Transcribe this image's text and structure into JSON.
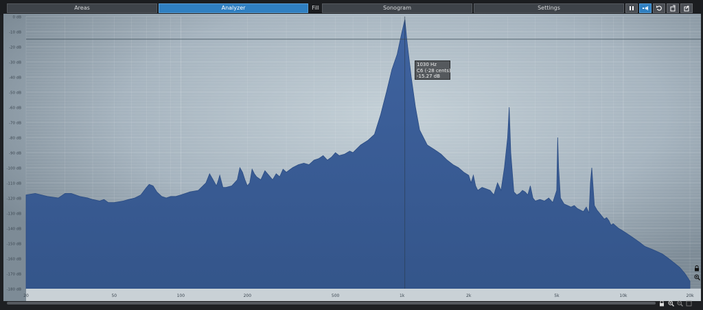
{
  "tabs": {
    "areas": "Areas",
    "analyzer": "Analyzer",
    "fill": "Fill",
    "sonogram": "Sonogram",
    "settings": "Settings"
  },
  "toolbar_icons": [
    "pause-icon",
    "freeze-icon",
    "reset-icon",
    "undo-icon",
    "export-icon"
  ],
  "colors": {
    "accent": "#2f7fc1",
    "spectrum_fill": "#3a5d96",
    "background_light": "#c4d0d7",
    "background_dark": "#7d8b96"
  },
  "tooltip": {
    "freq": "1030 Hz",
    "note": "C6 (-28 cents)",
    "level": "-15.27 dB"
  },
  "chart_data": {
    "type": "area",
    "x_scale": "log",
    "xlim": [
      20,
      20000
    ],
    "ylim": [
      -180,
      0
    ],
    "grid": true,
    "y_ticks": [
      "0 dB",
      "-10 dB",
      "-20 dB",
      "-30 dB",
      "-40 dB",
      "-50 dB",
      "-60 dB",
      "-70 dB",
      "-80 dB",
      "-90 dB",
      "-100 dB",
      "-110 dB",
      "-120 dB",
      "-130 dB",
      "-140 dB",
      "-150 dB",
      "-160 dB",
      "-170 dB",
      "-180 dB"
    ],
    "y_tick_values": [
      0,
      -10,
      -20,
      -30,
      -40,
      -50,
      -60,
      -70,
      -80,
      -90,
      -100,
      -110,
      -120,
      -130,
      -140,
      -150,
      -160,
      -170,
      -180
    ],
    "x_ticks": [
      "20",
      "50",
      "100",
      "200",
      "500",
      "1k",
      "2k",
      "5k",
      "10k",
      "20k"
    ],
    "x_tick_values": [
      20,
      50,
      100,
      200,
      500,
      1000,
      2000,
      5000,
      10000,
      20000
    ],
    "threshold_line_db": -15,
    "cursor_freq": 1030,
    "series": [
      {
        "x": [
          20,
          22,
          25,
          28,
          30,
          32,
          35,
          38,
          40,
          43,
          45,
          47,
          50,
          55,
          58,
          62,
          66,
          70,
          72,
          75,
          78,
          82,
          86,
          90,
          95,
          100,
          105,
          110,
          120,
          130,
          135,
          140,
          145,
          148,
          150,
          155,
          160,
          170,
          180,
          185,
          190,
          195,
          200,
          205,
          210,
          215,
          220,
          230,
          240,
          250,
          260,
          270,
          280,
          290,
          300,
          320,
          340,
          360,
          380,
          400,
          420,
          440,
          460,
          480,
          500,
          520,
          550,
          580,
          600,
          650,
          700,
          750,
          800,
          850,
          900,
          950,
          1000,
          1030,
          1050,
          1100,
          1150,
          1200,
          1300,
          1400,
          1500,
          1600,
          1700,
          1800,
          1900,
          2000,
          2050,
          2100,
          2150,
          2200,
          2300,
          2400,
          2500,
          2600,
          2700,
          2800,
          2900,
          3000,
          3050,
          3100,
          3200,
          3300,
          3400,
          3500,
          3600,
          3700,
          3800,
          3900,
          4000,
          4200,
          4400,
          4600,
          4800,
          5000,
          5050,
          5100,
          5200,
          5400,
          5600,
          5800,
          6000,
          6200,
          6400,
          6600,
          6800,
          7000,
          7100,
          7200,
          7400,
          7600,
          7800,
          8000,
          8200,
          8400,
          8600,
          8800,
          9000,
          9500,
          10000,
          10500,
          11000,
          11500,
          12000,
          12500,
          13000,
          13500,
          14000,
          15000,
          16000,
          17000,
          18000,
          19000,
          20000
        ],
        "y": [
          -118,
          -117,
          -119,
          -120,
          -117,
          -117,
          -119,
          -120,
          -121,
          -122,
          -121,
          -123,
          -123,
          -122,
          -121,
          -120,
          -118,
          -113,
          -111,
          -112,
          -116,
          -119,
          -120,
          -119,
          -119,
          -118,
          -117,
          -116,
          -115,
          -110,
          -104,
          -108,
          -112,
          -108,
          -105,
          -113,
          -113,
          -112,
          -108,
          -100,
          -103,
          -108,
          -112,
          -110,
          -101,
          -104,
          -106,
          -108,
          -102,
          -105,
          -108,
          -104,
          -106,
          -101,
          -103,
          -100,
          -98,
          -97,
          -98,
          -95,
          -94,
          -92,
          -95,
          -93,
          -90,
          -92,
          -91,
          -89,
          -90,
          -85,
          -82,
          -78,
          -65,
          -50,
          -35,
          -25,
          -10,
          -2,
          -15,
          -40,
          -60,
          -75,
          -85,
          -88,
          -91,
          -95,
          -98,
          -100,
          -103,
          -105,
          -110,
          -105,
          -112,
          -115,
          -113,
          -114,
          -115,
          -118,
          -110,
          -115,
          -100,
          -80,
          -60,
          -90,
          -116,
          -118,
          -117,
          -115,
          -116,
          -118,
          -112,
          -120,
          -122,
          -121,
          -122,
          -120,
          -123,
          -115,
          -80,
          -100,
          -120,
          -124,
          -125,
          -126,
          -125,
          -127,
          -128,
          -129,
          -126,
          -130,
          -110,
          -100,
          -125,
          -128,
          -130,
          -132,
          -134,
          -133,
          -135,
          -138,
          -137,
          -140,
          -142,
          -144,
          -146,
          -148,
          -150,
          -152,
          -153,
          -154,
          -155,
          -157,
          -160,
          -163,
          -166,
          -170,
          -175
        ]
      }
    ]
  }
}
